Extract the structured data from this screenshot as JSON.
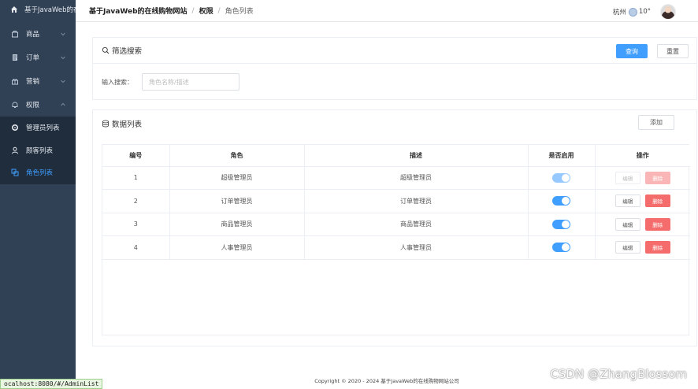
{
  "sidebar": {
    "title": "基于JavaWeb的在",
    "menus": [
      {
        "label": "商品",
        "icon": "shop-icon"
      },
      {
        "label": "订单",
        "icon": "order-icon"
      },
      {
        "label": "营销",
        "icon": "gift-icon"
      },
      {
        "label": "权限",
        "icon": "bell-icon"
      }
    ],
    "submenu": [
      {
        "label": "管理员列表",
        "icon": "settings-icon"
      },
      {
        "label": "顾客列表",
        "icon": "user-icon"
      },
      {
        "label": "角色列表",
        "icon": "role-icon"
      }
    ],
    "status_url": "ocalhost:8080/#/AdminList"
  },
  "header": {
    "breadcrumb": [
      "基于JavaWeb的在线购物网站",
      "权限",
      "角色列表"
    ],
    "separator": "/",
    "city": "杭州",
    "temperature": "10°"
  },
  "filter": {
    "title": "筛选搜索",
    "query_button": "查询",
    "reset_button": "重置",
    "input_label": "输入搜索：",
    "input_placeholder": "角色名称/描述",
    "input_value": ""
  },
  "list": {
    "title": "数据列表",
    "add_button": "添加",
    "columns": [
      "编号",
      "角色",
      "描述",
      "是否启用",
      "操作"
    ],
    "edit_label": "编辑",
    "delete_label": "删除",
    "rows": [
      {
        "id": "1",
        "role": "超级管理员",
        "desc": "超级管理员",
        "enabled": true,
        "disabled": true
      },
      {
        "id": "2",
        "role": "订单管理员",
        "desc": "订单管理员",
        "enabled": true,
        "disabled": false
      },
      {
        "id": "3",
        "role": "商品管理员",
        "desc": "商品管理员",
        "enabled": true,
        "disabled": false
      },
      {
        "id": "4",
        "role": "人事管理员",
        "desc": "人事管理员",
        "enabled": true,
        "disabled": false
      }
    ]
  },
  "footer": "Copyright © 2020 - 2024  基于JavaWeb的在线购物网站公司",
  "watermark": "CSDN @ZhangBlossom",
  "colors": {
    "primary": "#409eff",
    "danger": "#f56c6c",
    "sidebar": "#304156",
    "submenu": "#1f2d3d"
  }
}
